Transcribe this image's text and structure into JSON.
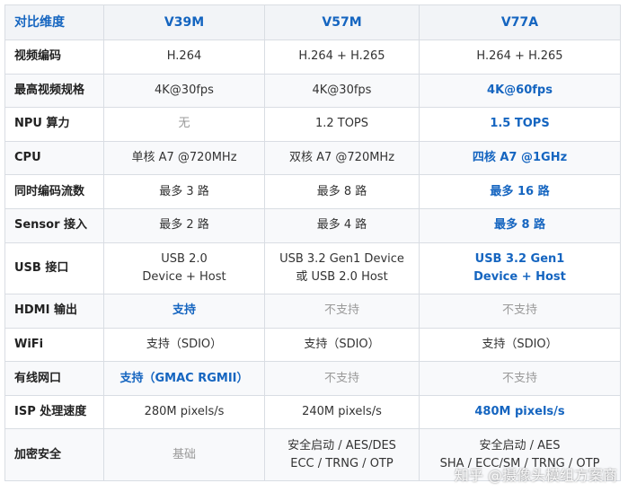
{
  "table": {
    "header": [
      "对比维度",
      "V39M",
      "V57M",
      "V77A"
    ],
    "rows": [
      {
        "label": "视频编码",
        "cells": [
          {
            "lines": [
              "H.264"
            ],
            "style": "normal"
          },
          {
            "lines": [
              "H.264 + H.265"
            ],
            "style": "normal"
          },
          {
            "lines": [
              "H.264 + H.265"
            ],
            "style": "normal"
          }
        ]
      },
      {
        "label": "最高视频规格",
        "cells": [
          {
            "lines": [
              "4K@30fps"
            ],
            "style": "normal"
          },
          {
            "lines": [
              "4K@30fps"
            ],
            "style": "normal"
          },
          {
            "lines": [
              "4K@60fps"
            ],
            "style": "highlight"
          }
        ]
      },
      {
        "label": "NPU 算力",
        "cells": [
          {
            "lines": [
              "无"
            ],
            "style": "muted"
          },
          {
            "lines": [
              "1.2 TOPS"
            ],
            "style": "normal"
          },
          {
            "lines": [
              "1.5 TOPS"
            ],
            "style": "highlight"
          }
        ]
      },
      {
        "label": "CPU",
        "cells": [
          {
            "lines": [
              "单核 A7 @720MHz"
            ],
            "style": "normal"
          },
          {
            "lines": [
              "双核 A7 @720MHz"
            ],
            "style": "normal"
          },
          {
            "lines": [
              "四核 A7 @1GHz"
            ],
            "style": "highlight"
          }
        ]
      },
      {
        "label": "同时编码流数",
        "cells": [
          {
            "lines": [
              "最多 3 路"
            ],
            "style": "normal"
          },
          {
            "lines": [
              "最多 8 路"
            ],
            "style": "normal"
          },
          {
            "lines": [
              "最多 16 路"
            ],
            "style": "highlight"
          }
        ]
      },
      {
        "label": "Sensor 接入",
        "cells": [
          {
            "lines": [
              "最多 2 路"
            ],
            "style": "normal"
          },
          {
            "lines": [
              "最多 4 路"
            ],
            "style": "normal"
          },
          {
            "lines": [
              "最多 8 路"
            ],
            "style": "highlight"
          }
        ]
      },
      {
        "label": "USB 接口",
        "cells": [
          {
            "lines": [
              "USB 2.0",
              "Device + Host"
            ],
            "style": "normal"
          },
          {
            "lines": [
              "USB 3.2 Gen1 Device",
              "或 USB 2.0 Host"
            ],
            "style": "normal"
          },
          {
            "lines": [
              "USB 3.2 Gen1",
              "Device + Host"
            ],
            "style": "highlight"
          }
        ]
      },
      {
        "label": "HDMI 输出",
        "cells": [
          {
            "lines": [
              "支持"
            ],
            "style": "highlight"
          },
          {
            "lines": [
              "不支持"
            ],
            "style": "muted"
          },
          {
            "lines": [
              "不支持"
            ],
            "style": "muted"
          }
        ]
      },
      {
        "label": "WiFi",
        "cells": [
          {
            "lines": [
              "支持（SDIO）"
            ],
            "style": "normal"
          },
          {
            "lines": [
              "支持（SDIO）"
            ],
            "style": "normal"
          },
          {
            "lines": [
              "支持（SDIO）"
            ],
            "style": "normal"
          }
        ]
      },
      {
        "label": "有线网口",
        "cells": [
          {
            "lines": [
              "支持（GMAC RGMII）"
            ],
            "style": "highlight"
          },
          {
            "lines": [
              "不支持"
            ],
            "style": "muted"
          },
          {
            "lines": [
              "不支持"
            ],
            "style": "muted"
          }
        ]
      },
      {
        "label": "ISP 处理速度",
        "cells": [
          {
            "lines": [
              "280M pixels/s"
            ],
            "style": "normal"
          },
          {
            "lines": [
              "240M pixels/s"
            ],
            "style": "normal"
          },
          {
            "lines": [
              "480M pixels/s"
            ],
            "style": "highlight"
          }
        ]
      },
      {
        "label": "加密安全",
        "cells": [
          {
            "lines": [
              "基础"
            ],
            "style": "muted"
          },
          {
            "lines": [
              "安全启动 / AES/DES",
              "ECC / TRNG / OTP"
            ],
            "style": "normal"
          },
          {
            "lines": [
              "安全启动 / AES",
              "SHA / ECC/SM / TRNG / OTP"
            ],
            "style": "normal"
          }
        ]
      }
    ]
  },
  "watermark": "知乎 @摄像头模组方案商",
  "colors": {
    "highlight": "#1565c0",
    "muted": "#9a9a9a",
    "text": "#333333",
    "border": "#d9dde3"
  }
}
